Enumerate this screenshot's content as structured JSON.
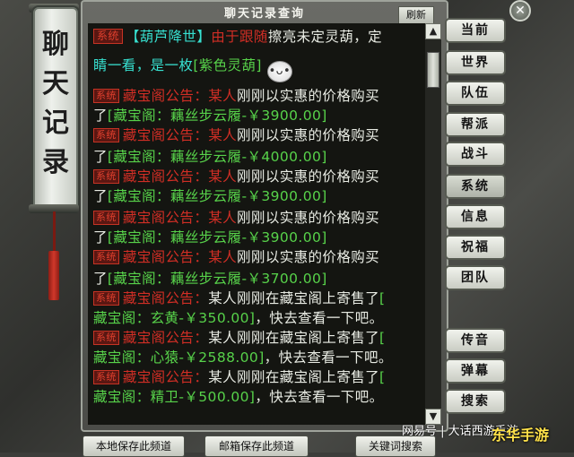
{
  "sidebar_title": [
    "聊",
    "天",
    "记",
    "录"
  ],
  "window": {
    "title": "聊天记录查询",
    "refresh": "刷新",
    "close": "✕"
  },
  "scroll": {
    "up": "▲",
    "down": "▼"
  },
  "messages": [
    {
      "tag": "系统",
      "parts": [
        [
          "cyan",
          "【葫芦降世】"
        ],
        [
          "red",
          "由于跟随"
        ],
        [
          "white",
          "擦亮未定灵葫，定"
        ]
      ]
    },
    {
      "tag": "",
      "parts": [
        [
          "cyan",
          "睛一看，是一枚"
        ],
        [
          "green",
          "[紫色灵葫]"
        ]
      ],
      "emoji": "•ᴗ•"
    },
    {
      "tag": "系统",
      "parts": [
        [
          "red",
          "藏宝阁公告：某人"
        ],
        [
          "white",
          "刚刚以实惠的价格购买"
        ]
      ]
    },
    {
      "tag": "",
      "parts": [
        [
          "white",
          "了"
        ],
        [
          "green",
          "[藏宝阁：藕丝步云履-￥3900.00]"
        ]
      ]
    },
    {
      "tag": "系统",
      "parts": [
        [
          "red",
          "藏宝阁公告：某人"
        ],
        [
          "white",
          "刚刚以实惠的价格购买"
        ]
      ]
    },
    {
      "tag": "",
      "parts": [
        [
          "white",
          "了"
        ],
        [
          "green",
          "[藏宝阁：藕丝步云履-￥4000.00]"
        ]
      ]
    },
    {
      "tag": "系统",
      "parts": [
        [
          "red",
          "藏宝阁公告：某人"
        ],
        [
          "white",
          "刚刚以实惠的价格购买"
        ]
      ]
    },
    {
      "tag": "",
      "parts": [
        [
          "white",
          "了"
        ],
        [
          "green",
          "[藏宝阁：藕丝步云履-￥3900.00]"
        ]
      ]
    },
    {
      "tag": "系统",
      "parts": [
        [
          "red",
          "藏宝阁公告：某人"
        ],
        [
          "white",
          "刚刚以实惠的价格购买"
        ]
      ]
    },
    {
      "tag": "",
      "parts": [
        [
          "white",
          "了"
        ],
        [
          "green",
          "[藏宝阁：藕丝步云履-￥3900.00]"
        ]
      ]
    },
    {
      "tag": "系统",
      "parts": [
        [
          "red",
          "藏宝阁公告：某人"
        ],
        [
          "white",
          "刚刚以实惠的价格购买"
        ]
      ]
    },
    {
      "tag": "",
      "parts": [
        [
          "white",
          "了"
        ],
        [
          "green",
          "[藏宝阁：藕丝步云履-￥3700.00]"
        ]
      ]
    },
    {
      "tag": "系统",
      "parts": [
        [
          "red",
          "藏宝阁公告："
        ],
        [
          "white",
          "某人刚刚在藏宝阁上寄售了"
        ],
        [
          "green",
          "["
        ]
      ]
    },
    {
      "tag": "",
      "parts": [
        [
          "green",
          "藏宝阁：玄黄-￥350.00]"
        ],
        [
          "white",
          "，快去查看一下吧。"
        ]
      ]
    },
    {
      "tag": "系统",
      "parts": [
        [
          "red",
          "藏宝阁公告："
        ],
        [
          "white",
          "某人刚刚在藏宝阁上寄售了"
        ],
        [
          "green",
          "["
        ]
      ]
    },
    {
      "tag": "",
      "parts": [
        [
          "green",
          "藏宝阁：心猿-￥2588.00]"
        ],
        [
          "white",
          "，快去查看一下吧。"
        ]
      ]
    },
    {
      "tag": "系统",
      "parts": [
        [
          "red",
          "藏宝阁公告："
        ],
        [
          "white",
          "某人刚刚在藏宝阁上寄售了"
        ],
        [
          "green",
          "["
        ]
      ]
    },
    {
      "tag": "",
      "parts": [
        [
          "green",
          "藏宝阁：精卫-￥500.00]"
        ],
        [
          "white",
          "，快去查看一下吧。"
        ]
      ]
    }
  ],
  "tabs_top": [
    "当前",
    "世界",
    "队伍",
    "帮派",
    "战斗",
    "系统",
    "信息",
    "祝福",
    "团队"
  ],
  "tabs_bottom": [
    "传音",
    "弹幕",
    "搜索"
  ],
  "active_tab": "系统",
  "bottom_buttons": [
    "本地保存此频道",
    "邮箱保存此频道",
    "关键词搜索"
  ],
  "watermarks": [
    "网易号 | 大话西游手游",
    "东华手游"
  ]
}
